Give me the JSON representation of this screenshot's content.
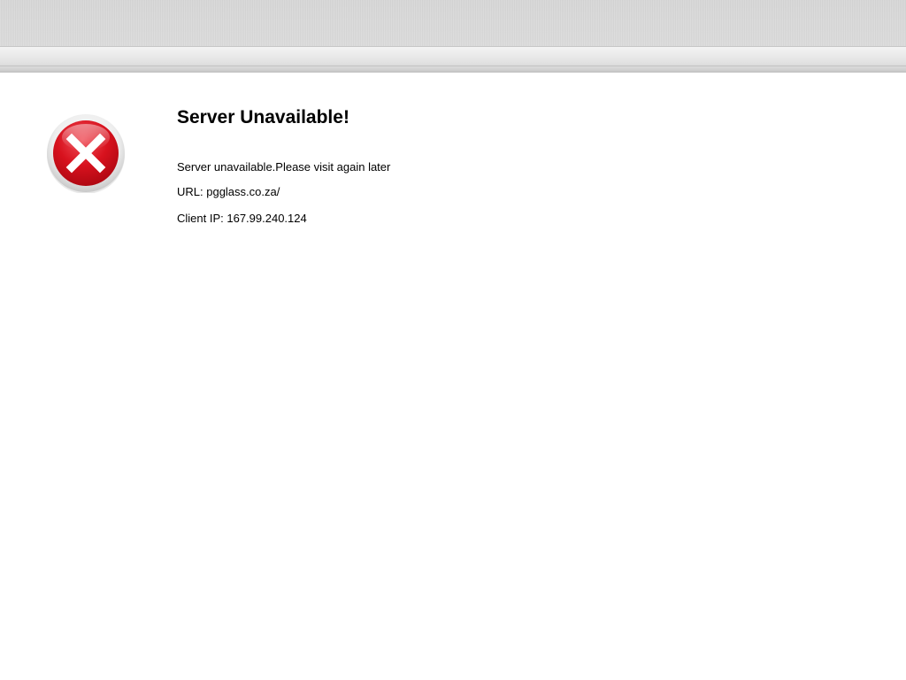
{
  "error": {
    "title": "Server Unavailable!",
    "message": "Server unavailable.Please visit again later",
    "url_line": "URL: pgglass.co.za/",
    "client_ip_line": "Client IP: 167.99.240.124"
  },
  "icons": {
    "error": "error-x-icon"
  },
  "colors": {
    "icon_red": "#d4101a",
    "icon_ring": "#e6e6e6",
    "background": "#ffffff"
  }
}
